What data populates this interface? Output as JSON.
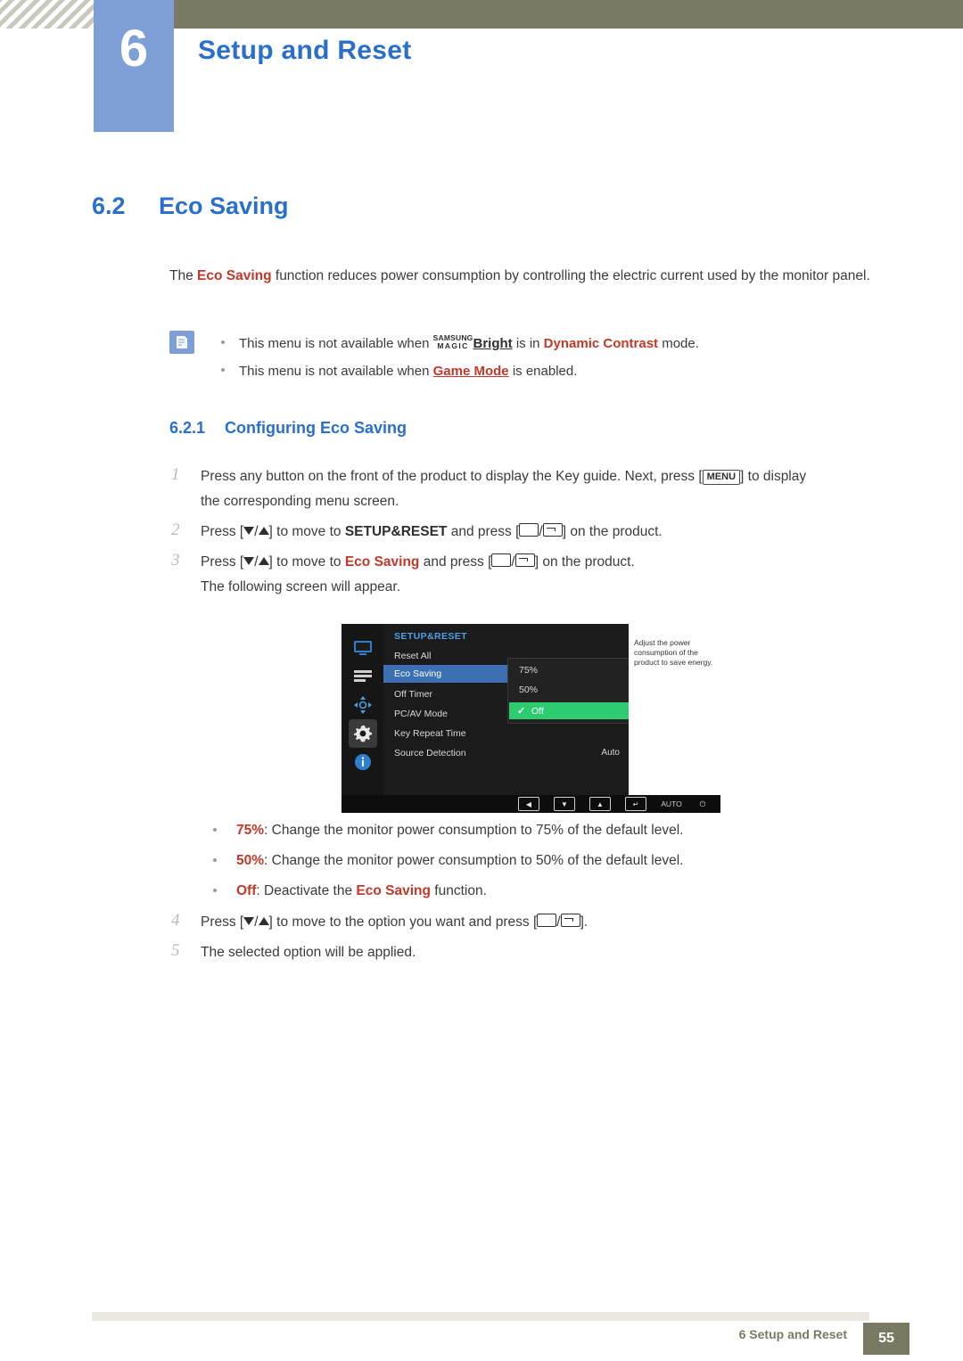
{
  "header": {
    "chapter_number": "6",
    "chapter_title": "Setup and Reset"
  },
  "section": {
    "number": "6.2",
    "title": "Eco Saving"
  },
  "intro": {
    "part1": "The ",
    "term": "Eco Saving",
    "part2": " function reduces power consumption by controlling the electric current used by the monitor panel."
  },
  "notes": [
    {
      "pre": "This menu is not available when ",
      "magic_line1": "SAMSUNG",
      "magic_line2": "MAGIC",
      "magic_word": "Bright",
      "mid": " is in ",
      "term": "Dynamic Contrast",
      "post": " mode."
    },
    {
      "pre": "This menu is not available when ",
      "term": "Game Mode",
      "post": " is enabled."
    }
  ],
  "subsection": {
    "number": "6.2.1",
    "title": "Configuring Eco Saving"
  },
  "steps": [
    {
      "num": "1",
      "line1_a": "Press any button on the front of the product to display the Key guide. Next, press [",
      "key": "MENU",
      "line1_b": "] to display",
      "line2": "the corresponding menu screen."
    },
    {
      "num": "2",
      "a": "Press [",
      "b": "/",
      "c": "] to move to ",
      "target": "SETUP&RESET",
      "d": " and press [",
      "e": "/",
      "f": "] on the product."
    },
    {
      "num": "3",
      "a": "Press [",
      "b": "/",
      "c": "] to move to ",
      "target": "Eco Saving",
      "d": " and press [",
      "e": "/",
      "f": "] on the product.",
      "line2": "The following screen will appear."
    },
    {
      "num": "4",
      "a": "Press [",
      "b": "/",
      "c": "] to move to the option you want and press [",
      "d": "/",
      "e": "]."
    },
    {
      "num": "5",
      "text": "The selected option will be applied."
    }
  ],
  "osd": {
    "menu_title": "SETUP&RESET",
    "items": [
      {
        "label": "Reset All",
        "value": ""
      },
      {
        "label": "Eco Saving",
        "value": "",
        "selected": true
      },
      {
        "label": "Off Timer",
        "value": ""
      },
      {
        "label": "PC/AV Mode",
        "value": ""
      },
      {
        "label": "Key Repeat Time",
        "value": ""
      },
      {
        "label": "Source Detection",
        "value": "Auto"
      }
    ],
    "submenu": [
      {
        "label": "75%",
        "selected": false
      },
      {
        "label": "50%",
        "selected": false
      },
      {
        "label": "Off",
        "selected": true
      }
    ],
    "check_glyph": "✓",
    "help_text": "Adjust the power consumption of the product to save energy.",
    "bottom_bar": {
      "auto_label": "AUTO",
      "power_glyph": "⏻",
      "back_glyph": "◀",
      "down_glyph": "▼",
      "up_glyph": "▲"
    },
    "sidebar_icons": [
      "monitor-icon",
      "picture-icon",
      "color-icon",
      "gear-icon",
      "info-icon"
    ]
  },
  "options": [
    {
      "term": "75%",
      "text": ": Change the monitor power consumption to 75% of the default level."
    },
    {
      "term": "50%",
      "text": ": Change the monitor power consumption to 50% of the default level."
    },
    {
      "term": "Off",
      "pre": ": Deactivate the ",
      "term2": "Eco Saving",
      "post": " function."
    }
  ],
  "footer": {
    "text": "6 Setup and Reset",
    "page": "55"
  }
}
